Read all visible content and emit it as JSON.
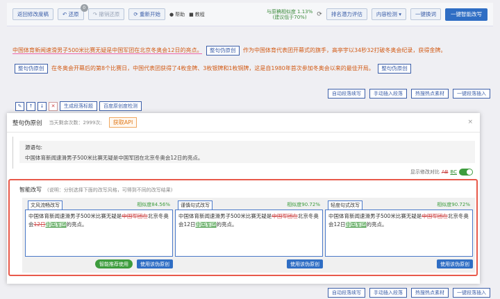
{
  "toolbar": {
    "back_label": "返回修改度稿",
    "undo_label": "还原",
    "undo_badge": "0",
    "redo_label": "撤销还原",
    "restart_label": "重新开始",
    "help_label": "帮助",
    "tutorial_label": "教程",
    "similarity_line1": "与原稿相似度 1.13%",
    "similarity_line2": "(建议低于70%)",
    "rank_label": "排名潜力评估",
    "content_check_label": "内容检测",
    "one_click_replace_label": "一键换词",
    "smart_rewrite_label": "一键智能改写"
  },
  "document": {
    "para1_a": "中国体育新闻速滑男子500米比赛无疑是中国军团在北京冬奥会12日的亮点。",
    "tag1": "整句伪原创",
    "para1_b": "作为中国体育代表团开幕式的旗手，高亭宇以34秒32打破冬奥会纪录，获得金牌。",
    "tag2": "整句伪原创",
    "para2_a": "在冬奥会开幕后的第8个比赛日，中国代表团获得了4枚金牌、3枚银牌和1枚铜牌，这是自1980年首次参加冬奥会以来的最佳开局。",
    "tag3": "整句伪原创",
    "buttons": [
      "自动段落续写",
      "手动插入段落",
      "热搜热点素材",
      "一键段落插入"
    ],
    "mini_tools": [
      "✎",
      "↑",
      "↓",
      "✕"
    ],
    "gen_title_label": "生成段落标题",
    "baidu_check_label": "百度原创度检测"
  },
  "modal": {
    "title": "整句伪原创",
    "remaining": "当天剩余次数：2999次;",
    "api_label": "获取API",
    "close_label": "×",
    "source_label": "源语句:",
    "source_text": "中国体育新闻速滑男子500米比赛无疑是中国军团在北京冬奥会12日的亮点。",
    "toggle_label": "显示修改对比",
    "toggle_old": "AB",
    "toggle_new": "BC",
    "smart_title": "智能改写",
    "smart_note": "(说明：分别选择下面的改写风格，可得到不同的改写结果)",
    "recommend_label": "智能推荐使用",
    "cards": [
      {
        "style": "文风流畅改写",
        "similarity": "相似度84.56%",
        "text_a": "中国体育新闻速滑男子500米比赛无疑是",
        "text_del": "中国军团在",
        "text_b": "北京冬奥会",
        "text_del2": "12日",
        "text_add": "中国军团",
        "text_c": "的亮点。",
        "use_label": "使用该伪原创"
      },
      {
        "style": "谨慎句式改写",
        "similarity": "相似度90.72%",
        "text_a": "中国体育新闻速滑男子500米比赛无疑是",
        "text_del": "中国军团在",
        "text_b": "北京冬奥会12日",
        "text_del2": "",
        "text_add": "中国军团",
        "text_c": "的亮点。",
        "use_label": "使用该伪原创"
      },
      {
        "style": "轻度句式改写",
        "similarity": "相似度90.72%",
        "text_a": "中国体育新闻速滑男子500米比赛无疑是",
        "text_del": "中国军团在",
        "text_b": "北京冬奥会12日",
        "text_del2": "",
        "text_add": "中国军团",
        "text_c": "的亮点。",
        "use_label": "使用该伪原创"
      }
    ],
    "bottom_buttons": [
      "自动段落续写",
      "手动插入段落",
      "热搜热点素材",
      "一键段落插入"
    ]
  }
}
